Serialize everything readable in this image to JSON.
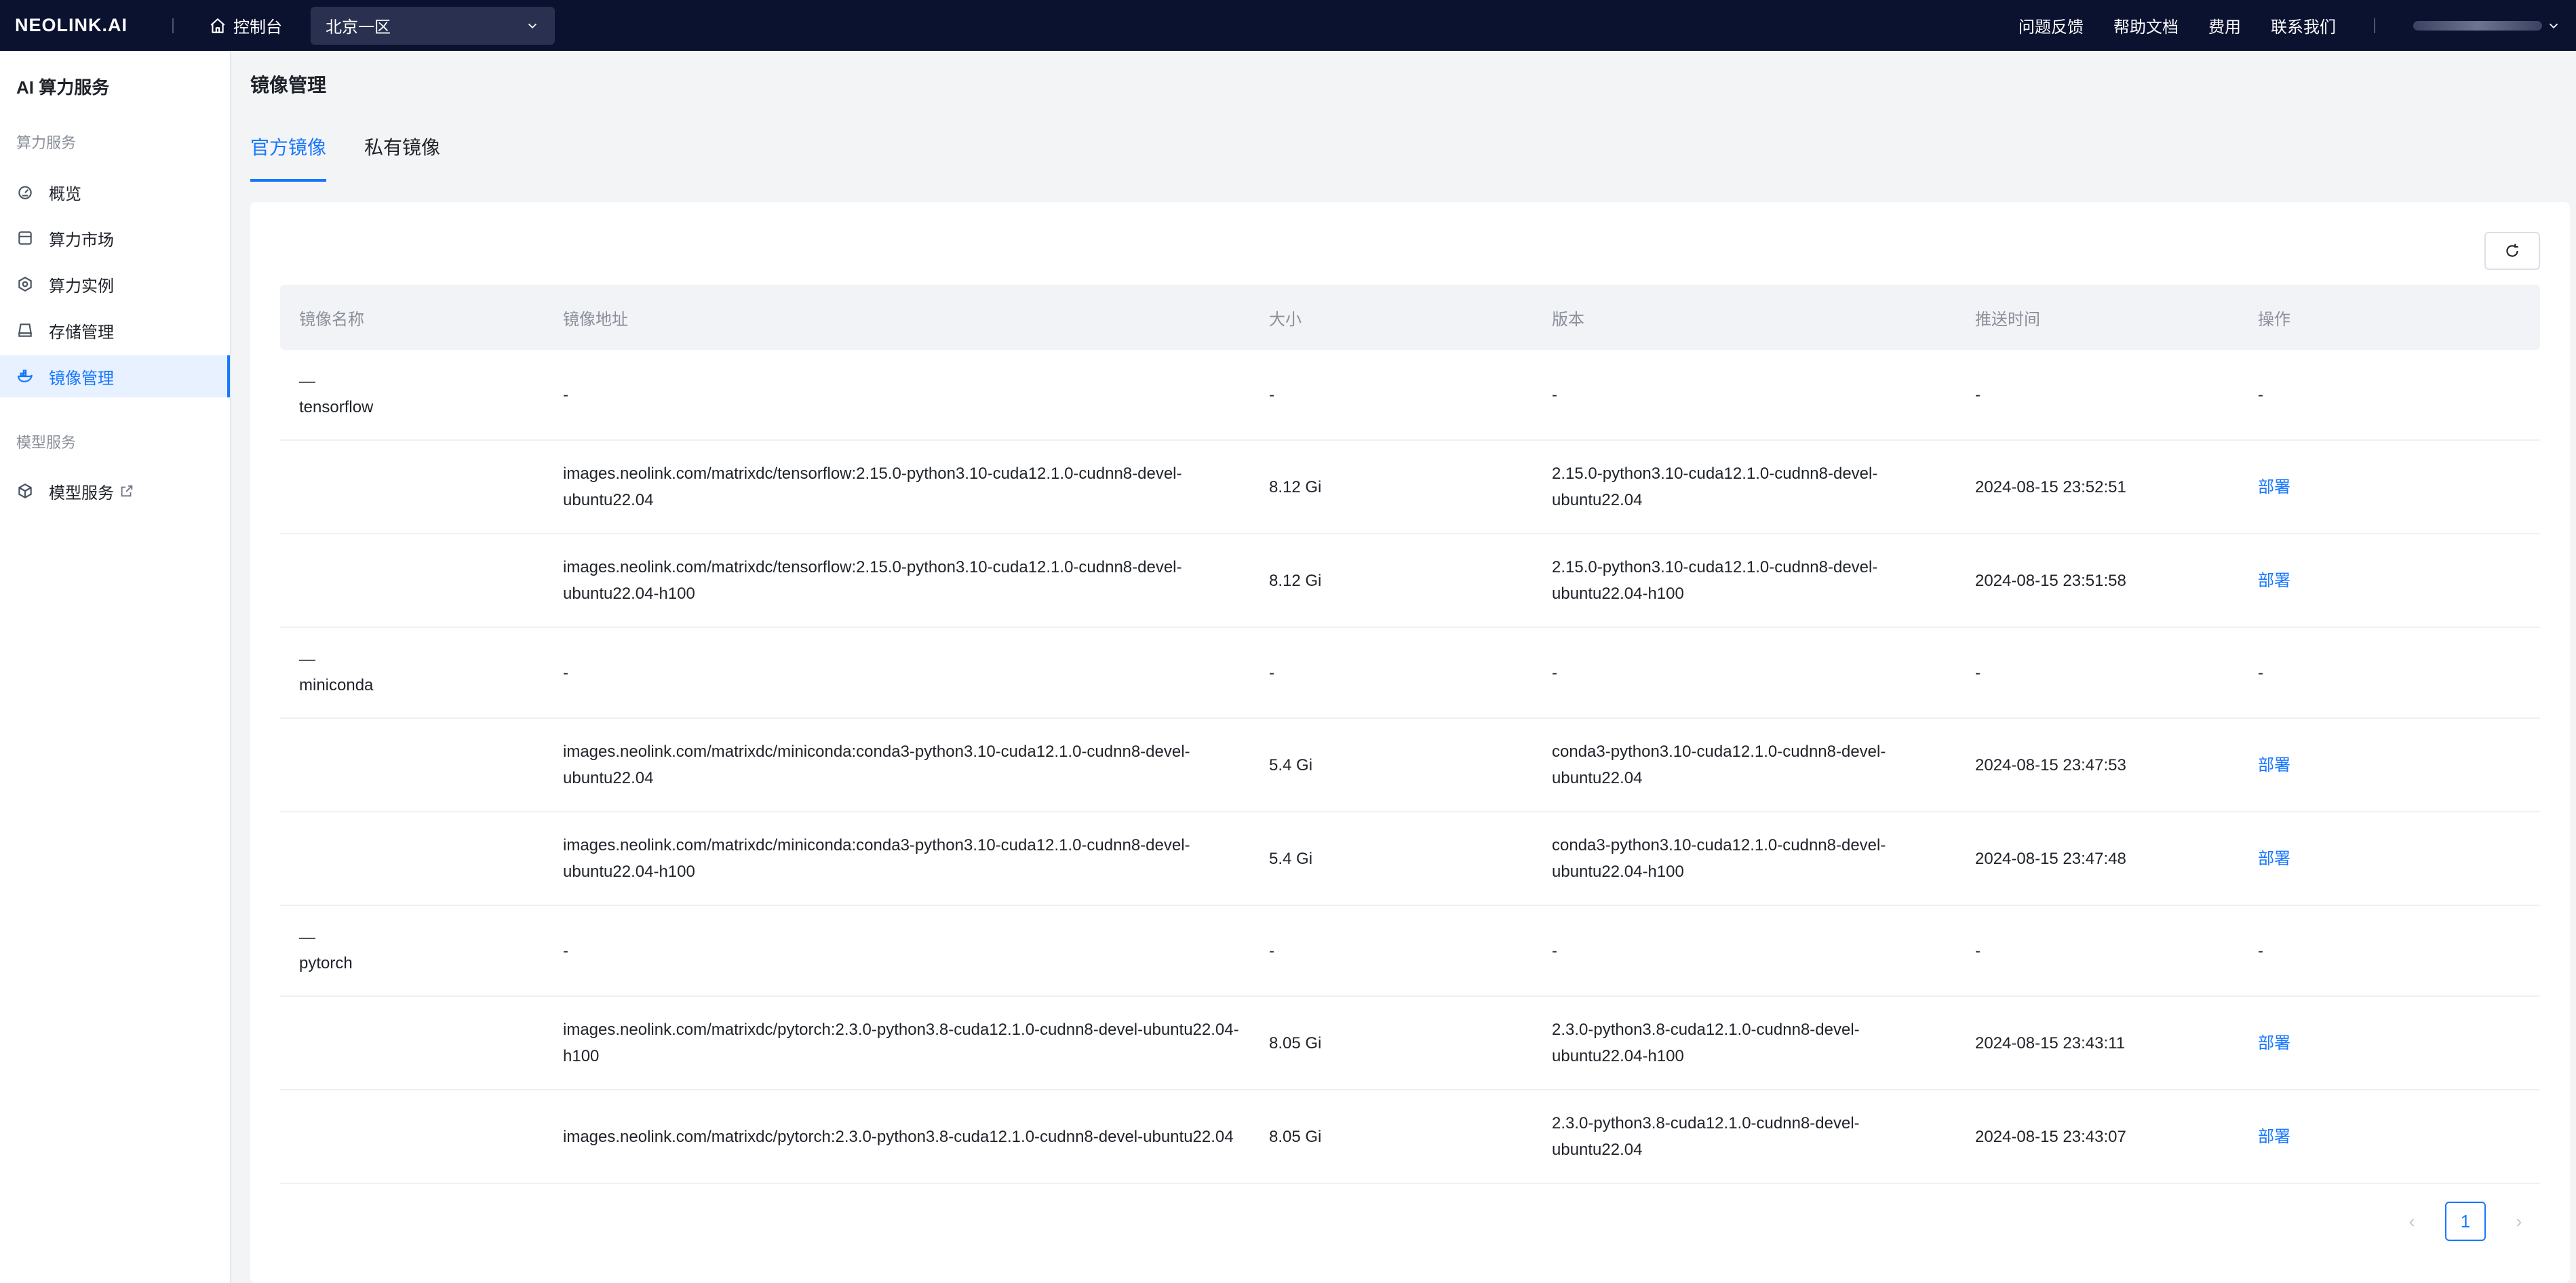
{
  "topbar": {
    "brand": "NEOLINK.AI",
    "console": "控制台",
    "region": "北京一区",
    "links": [
      "问题反馈",
      "帮助文档",
      "费用",
      "联系我们"
    ]
  },
  "sidebar": {
    "title": "AI 算力服务",
    "group1": "算力服务",
    "items": [
      {
        "label": "概览",
        "icon": "dashboard-icon"
      },
      {
        "label": "算力市场",
        "icon": "store-icon"
      },
      {
        "label": "算力实例",
        "icon": "instance-icon"
      },
      {
        "label": "存储管理",
        "icon": "storage-icon"
      },
      {
        "label": "镜像管理",
        "icon": "docker-icon",
        "active": true
      }
    ],
    "group2": "模型服务",
    "model_item": {
      "label": "模型服务",
      "icon": "model-icon"
    }
  },
  "main": {
    "title": "镜像管理",
    "tabs": [
      {
        "label": "官方镜像",
        "active": true
      },
      {
        "label": "私有镜像",
        "active": false
      }
    ]
  },
  "table": {
    "headers": [
      "镜像名称",
      "镜像地址",
      "大小",
      "版本",
      "推送时间",
      "操作"
    ],
    "groups": [
      {
        "name": "tensorflow",
        "collapse": "—",
        "placeholder": "-",
        "rows": [
          {
            "address": "images.neolink.com/matrixdc/tensorflow:2.15.0-python3.10-cuda12.1.0-cudnn8-devel-ubuntu22.04",
            "size": "8.12 Gi",
            "version": "2.15.0-python3.10-cuda12.1.0-cudnn8-devel-ubuntu22.04",
            "time": "2024-08-15 23:52:51",
            "action": "部署"
          },
          {
            "address": "images.neolink.com/matrixdc/tensorflow:2.15.0-python3.10-cuda12.1.0-cudnn8-devel-ubuntu22.04-h100",
            "size": "8.12 Gi",
            "version": "2.15.0-python3.10-cuda12.1.0-cudnn8-devel-ubuntu22.04-h100",
            "time": "2024-08-15 23:51:58",
            "action": "部署"
          }
        ]
      },
      {
        "name": "miniconda",
        "collapse": "—",
        "placeholder": "-",
        "rows": [
          {
            "address": "images.neolink.com/matrixdc/miniconda:conda3-python3.10-cuda12.1.0-cudnn8-devel-ubuntu22.04",
            "size": "5.4 Gi",
            "version": "conda3-python3.10-cuda12.1.0-cudnn8-devel-ubuntu22.04",
            "time": "2024-08-15 23:47:53",
            "action": "部署"
          },
          {
            "address": "images.neolink.com/matrixdc/miniconda:conda3-python3.10-cuda12.1.0-cudnn8-devel-ubuntu22.04-h100",
            "size": "5.4 Gi",
            "version": "conda3-python3.10-cuda12.1.0-cudnn8-devel-ubuntu22.04-h100",
            "time": "2024-08-15 23:47:48",
            "action": "部署"
          }
        ]
      },
      {
        "name": "pytorch",
        "collapse": "—",
        "placeholder": "-",
        "rows": [
          {
            "address": "images.neolink.com/matrixdc/pytorch:2.3.0-python3.8-cuda12.1.0-cudnn8-devel-ubuntu22.04-h100",
            "size": "8.05 Gi",
            "version": "2.3.0-python3.8-cuda12.1.0-cudnn8-devel-ubuntu22.04-h100",
            "time": "2024-08-15 23:43:11",
            "action": "部署"
          },
          {
            "address": "images.neolink.com/matrixdc/pytorch:2.3.0-python3.8-cuda12.1.0-cudnn8-devel-ubuntu22.04",
            "size": "8.05 Gi",
            "version": "2.3.0-python3.8-cuda12.1.0-cudnn8-devel-ubuntu22.04",
            "time": "2024-08-15 23:43:07",
            "action": "部署"
          }
        ]
      }
    ]
  },
  "pagination": {
    "current": "1",
    "prev": "‹",
    "next": "›"
  },
  "colors": {
    "topbar": "#0b1230",
    "accent": "#1677ff",
    "active_bg": "#e8f1ff"
  }
}
